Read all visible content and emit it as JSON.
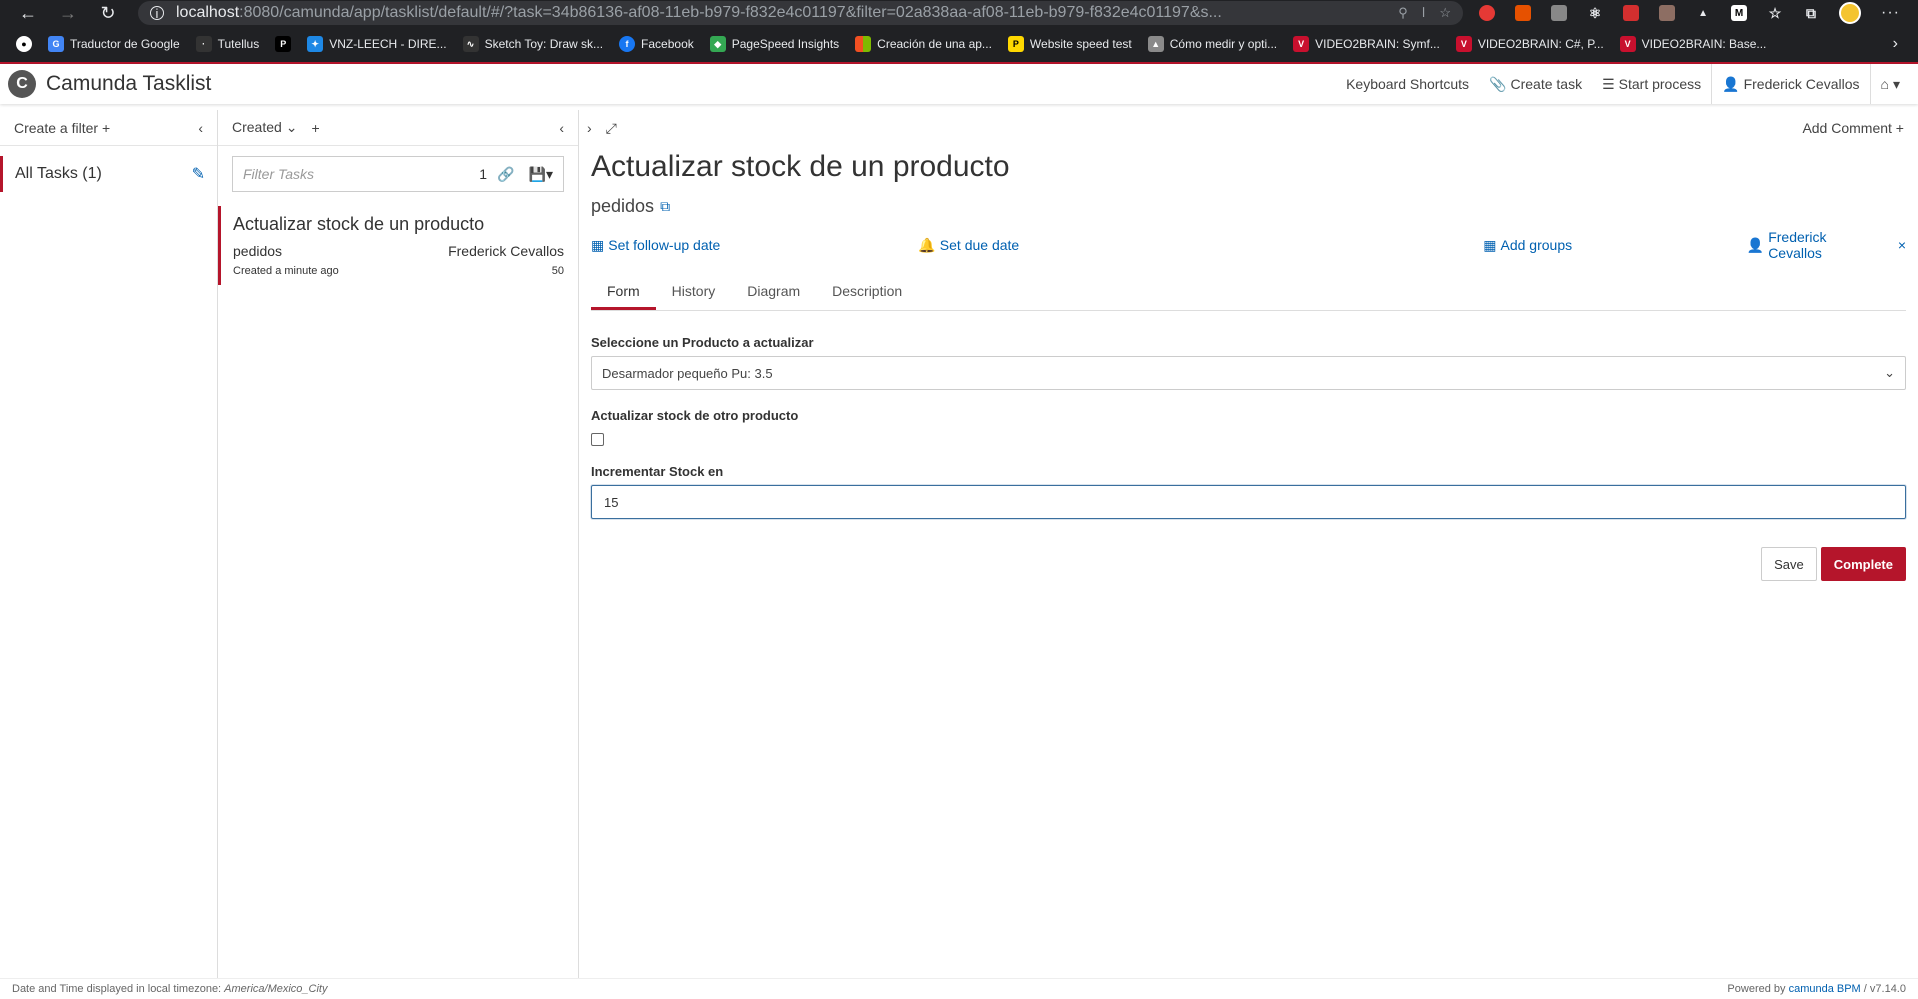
{
  "browser": {
    "url_host": "localhost",
    "url_rest": ":8080/camunda/app/tasklist/default/#/?task=34b86136-af08-11eb-b979-f832e4c01197&filter=02a838aa-af08-11eb-b979-f832e4c01197&s...",
    "bookmarks": [
      {
        "label": "Traductor de Google",
        "icon": "google-translate-icon",
        "color": "#4285f4"
      },
      {
        "label": "Tutellus",
        "icon": "tutellus-icon",
        "color": "#333333"
      },
      {
        "label": "",
        "icon": "p-icon",
        "color": "#000000"
      },
      {
        "label": "VNZ-LEECH - DIRE...",
        "icon": "vnz-icon",
        "color": "#1e88e5"
      },
      {
        "label": "Sketch Toy: Draw sk...",
        "icon": "sketch-icon",
        "color": "#333333"
      },
      {
        "label": "Facebook",
        "icon": "facebook-icon",
        "color": "#1877f2"
      },
      {
        "label": "PageSpeed Insights",
        "icon": "pagespeed-icon",
        "color": "#34a853"
      },
      {
        "label": "Creación de una ap...",
        "icon": "microsoft-icon",
        "color": "#f25022"
      },
      {
        "label": "Website speed test",
        "icon": "speedtest-icon",
        "color": "#ffd800"
      },
      {
        "label": "Cómo medir y opti...",
        "icon": "measure-icon",
        "color": "#8a8a8a"
      },
      {
        "label": "VIDEO2BRAIN: Symf...",
        "icon": "video2brain-icon",
        "color": "#c8102e"
      },
      {
        "label": "VIDEO2BRAIN: C#, P...",
        "icon": "video2brain-icon",
        "color": "#c8102e"
      },
      {
        "label": "VIDEO2BRAIN: Base...",
        "icon": "video2brain-icon",
        "color": "#c8102e"
      }
    ]
  },
  "header": {
    "title": "Camunda Tasklist",
    "keyboard_shortcuts": "Keyboard Shortcuts",
    "create_task": "Create task",
    "start_process": "Start process",
    "user": "Frederick Cevallos"
  },
  "filters": {
    "create_label": "Create a filter",
    "items": [
      {
        "label": "All Tasks (1)"
      }
    ]
  },
  "list": {
    "sort_label": "Created",
    "search_placeholder": "Filter Tasks",
    "count": "1",
    "tasks": [
      {
        "name": "Actualizar stock de un producto",
        "process": "pedidos",
        "assignee": "Frederick Cevallos",
        "created": "Created a minute ago",
        "priority": "50"
      }
    ]
  },
  "task": {
    "add_comment": "Add Comment",
    "title": "Actualizar stock de un producto",
    "process": "pedidos",
    "follow_up": "Set follow-up date",
    "due_date": "Set due date",
    "add_groups": "Add groups",
    "assignee": "Frederick Cevallos",
    "tabs": [
      "Form",
      "History",
      "Diagram",
      "Description"
    ],
    "form": {
      "product_label": "Seleccione un Producto a actualizar",
      "product_value": "Desarmador pequeño Pu: 3.5",
      "other_label": "Actualizar stock de otro producto",
      "other_checked": false,
      "increment_label": "Incrementar Stock en",
      "increment_value": "15"
    },
    "save": "Save",
    "complete": "Complete"
  },
  "footer": {
    "tz_prefix": "Date and Time displayed in local timezone: ",
    "tz": "America/Mexico_City",
    "powered": "Powered by ",
    "brand": "camunda BPM",
    "version": " / v7.14.0"
  },
  "colors": {
    "accent": "#b5152b",
    "link": "#0060b0"
  }
}
